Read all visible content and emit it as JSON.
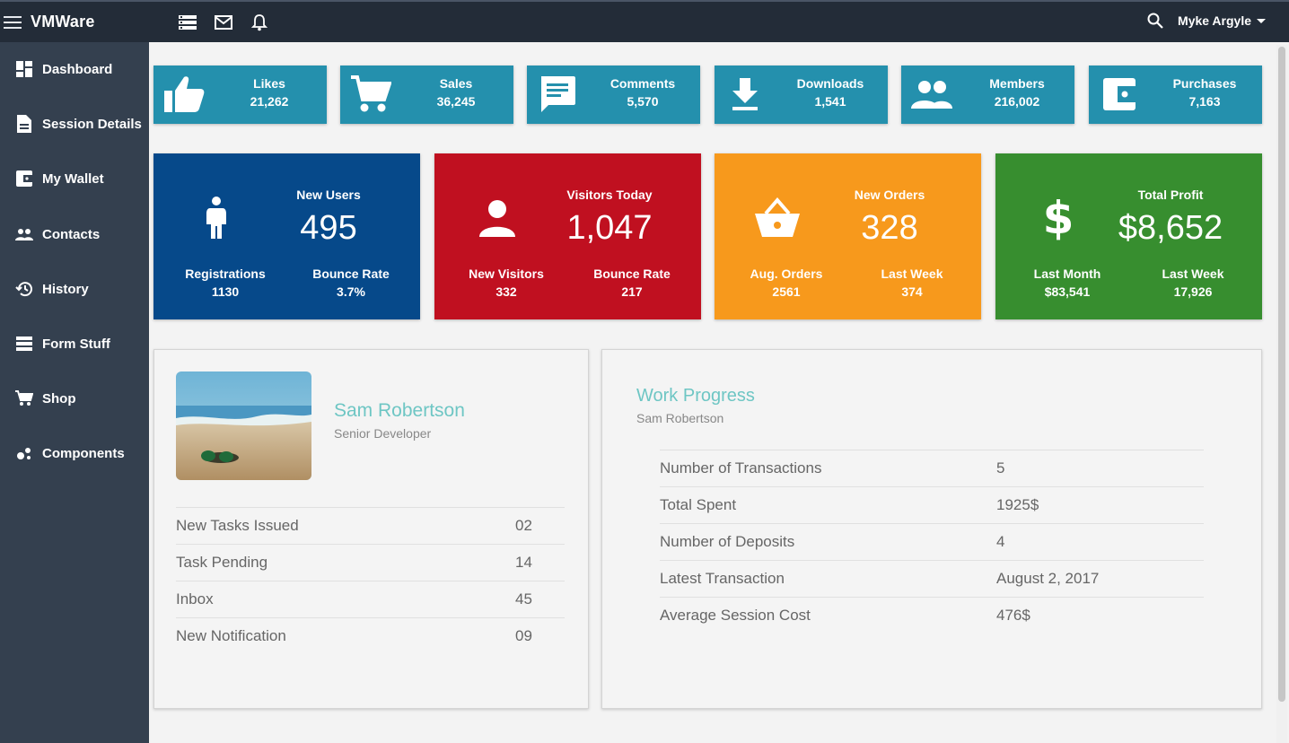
{
  "app": {
    "brand": "VMWare"
  },
  "topbar": {
    "icons": [
      "list-icon",
      "mail-icon",
      "bell-icon"
    ],
    "search_icon": "search-icon",
    "user": "Myke Argyle"
  },
  "sidebar": {
    "items": [
      {
        "label": "Dashboard",
        "icon": "dashboard-icon"
      },
      {
        "label": "Session Details",
        "icon": "document-icon"
      },
      {
        "label": "My Wallet",
        "icon": "wallet-icon"
      },
      {
        "label": "Contacts",
        "icon": "contacts-icon"
      },
      {
        "label": "History",
        "icon": "history-icon"
      },
      {
        "label": "Form Stuff",
        "icon": "form-icon"
      },
      {
        "label": "Shop",
        "icon": "cart-icon"
      },
      {
        "label": "Components",
        "icon": "components-icon"
      }
    ]
  },
  "stats": [
    {
      "label": "Likes",
      "value": "21,262",
      "icon": "thumbs-up-icon"
    },
    {
      "label": "Sales",
      "value": "36,245",
      "icon": "cart-icon"
    },
    {
      "label": "Comments",
      "value": "5,570",
      "icon": "comment-icon"
    },
    {
      "label": "Downloads",
      "value": "1,541",
      "icon": "download-icon"
    },
    {
      "label": "Members",
      "value": "216,002",
      "icon": "people-icon"
    },
    {
      "label": "Purchases",
      "value": "7,163",
      "icon": "wallet-icon"
    }
  ],
  "stat_color": "#2490ad",
  "tiles": [
    {
      "title": "New Users",
      "value": "495",
      "left_label": "Registrations",
      "left_value": "1130",
      "right_label": "Bounce Rate",
      "right_value": "3.7%",
      "color": "#06498a",
      "icon": "person-standing-icon"
    },
    {
      "title": "Visitors Today",
      "value": "1,047",
      "left_label": "New Visitors",
      "left_value": "332",
      "right_label": "Bounce Rate",
      "right_value": "217",
      "color": "#c01020",
      "icon": "person-icon"
    },
    {
      "title": "New Orders",
      "value": "328",
      "left_label": "Aug. Orders",
      "left_value": "2561",
      "right_label": "Last Week",
      "right_value": "374",
      "color": "#f7991c",
      "icon": "basket-icon"
    },
    {
      "title": "Total Profit",
      "value": "$8,652",
      "left_label": "Last Month",
      "left_value": "$83,541",
      "right_label": "Last Week",
      "right_value": "17,926",
      "color": "#378e2f",
      "icon": "dollar-icon"
    }
  ],
  "profile": {
    "name": "Sam Robertson",
    "role": "Senior Developer",
    "rows": [
      {
        "label": "New Tasks Issued",
        "value": "02"
      },
      {
        "label": "Task Pending",
        "value": "14"
      },
      {
        "label": "Inbox",
        "value": "45"
      },
      {
        "label": "New Notification",
        "value": "09"
      }
    ]
  },
  "progress": {
    "title": "Work Progress",
    "subtitle": "Sam Robertson",
    "rows": [
      {
        "label": "Number of Transactions",
        "value": "5"
      },
      {
        "label": "Total Spent",
        "value": "1925$"
      },
      {
        "label": "Number of Deposits",
        "value": "4"
      },
      {
        "label": "Latest Transaction",
        "value": "August 2, 2017"
      },
      {
        "label": "Average Session Cost",
        "value": "476$"
      }
    ]
  }
}
